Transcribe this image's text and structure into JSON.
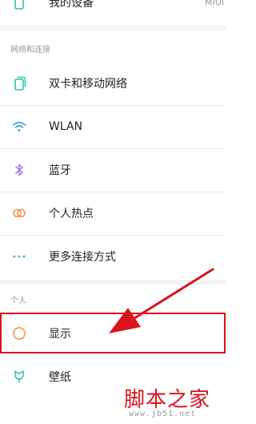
{
  "colors": {
    "accent_red": "#d9141c",
    "icon_green": "#2ec4a9",
    "icon_blue": "#3aa6e8",
    "icon_purple": "#a37fe0",
    "icon_orange": "#f0934a"
  },
  "top_item": {
    "label": "我的设备",
    "value": "MIUI",
    "icon": "phone-icon"
  },
  "network_section": {
    "header": "网络和连接",
    "items": [
      {
        "label": "双卡和移动网络",
        "icon": "sim-card-icon"
      },
      {
        "label": "WLAN",
        "icon": "wifi-icon"
      },
      {
        "label": "蓝牙",
        "icon": "bluetooth-icon"
      },
      {
        "label": "个人热点",
        "icon": "hotspot-icon"
      },
      {
        "label": "更多连接方式",
        "icon": "more-dots-icon"
      }
    ]
  },
  "personal_section": {
    "header": "个人",
    "items": [
      {
        "label": "显示",
        "icon": "display-brightness-icon",
        "highlighted": true
      },
      {
        "label": "壁纸",
        "icon": "wallpaper-icon"
      }
    ]
  },
  "watermark": {
    "title": "脚本之家",
    "url": "www.jb51.net"
  }
}
